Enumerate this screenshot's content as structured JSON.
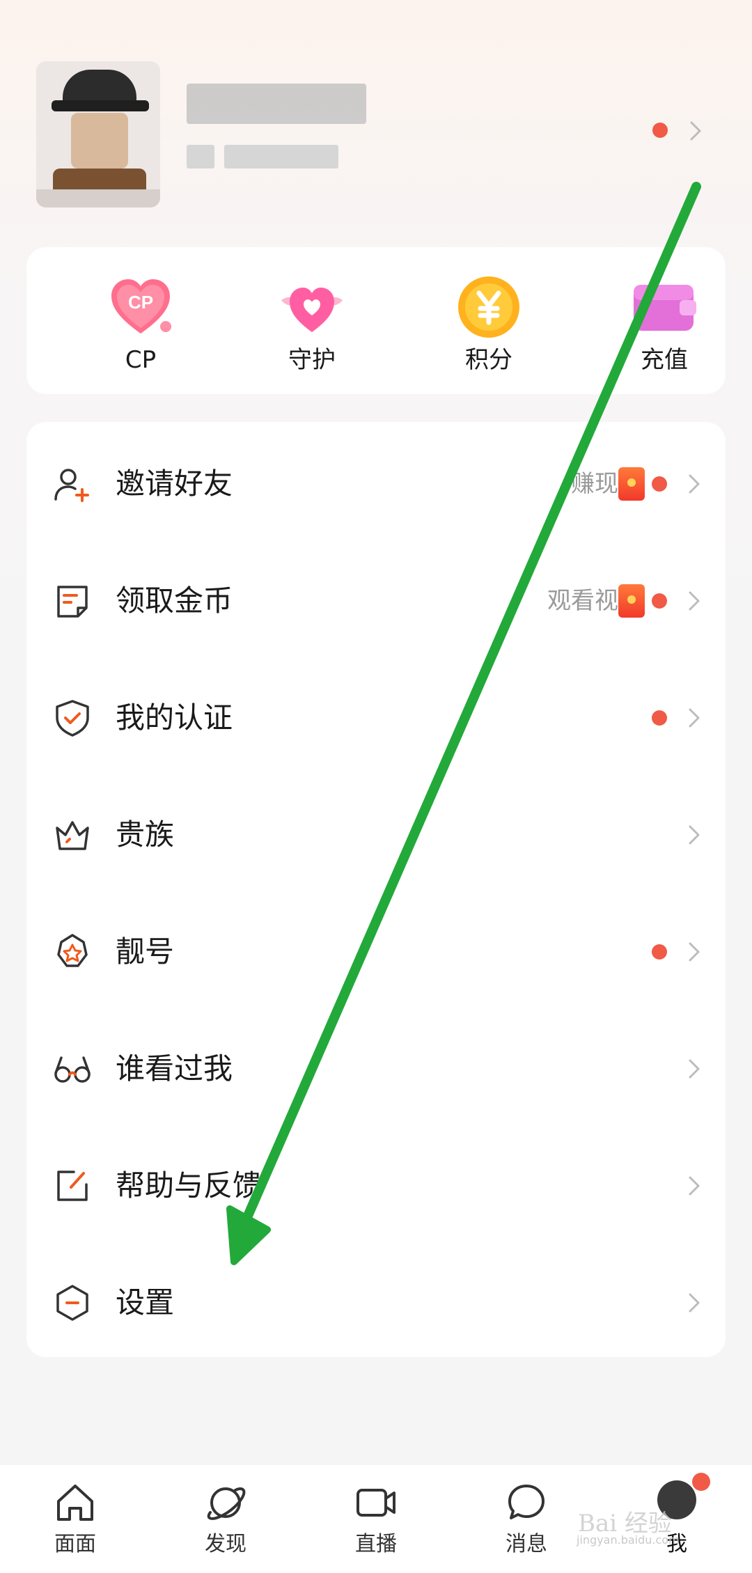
{
  "profile": {
    "has_notification": true
  },
  "quick_actions": [
    {
      "label": "CP",
      "icon": "cp-heart-icon"
    },
    {
      "label": "守护",
      "icon": "winged-heart-icon"
    },
    {
      "label": "积分",
      "icon": "yuan-coin-icon"
    },
    {
      "label": "充值",
      "icon": "wallet-icon"
    }
  ],
  "menu": [
    {
      "label": "邀请好友",
      "hint": "赚现金",
      "redpacket": true,
      "dot": true,
      "icon": "add-user-icon"
    },
    {
      "label": "领取金币",
      "hint": "观看视频",
      "redpacket": true,
      "dot": true,
      "icon": "note-icon"
    },
    {
      "label": "我的认证",
      "hint": "",
      "redpacket": false,
      "dot": true,
      "icon": "shield-check-icon"
    },
    {
      "label": "贵族",
      "hint": "",
      "redpacket": false,
      "dot": false,
      "icon": "crown-icon"
    },
    {
      "label": "靓号",
      "hint": "",
      "redpacket": false,
      "dot": true,
      "icon": "star-badge-icon"
    },
    {
      "label": "谁看过我",
      "hint": "",
      "redpacket": false,
      "dot": false,
      "icon": "glasses-icon"
    },
    {
      "label": "帮助与反馈",
      "hint": "",
      "redpacket": false,
      "dot": false,
      "icon": "edit-icon"
    },
    {
      "label": "设置",
      "hint": "",
      "redpacket": false,
      "dot": false,
      "icon": "hexagon-settings-icon"
    }
  ],
  "bottom_nav": [
    {
      "label": "面面",
      "icon": "home-icon"
    },
    {
      "label": "发现",
      "icon": "planet-icon"
    },
    {
      "label": "直播",
      "icon": "video-camera-icon"
    },
    {
      "label": "消息",
      "icon": "chat-bubble-icon"
    },
    {
      "label": "我",
      "icon": "avatar-icon",
      "active": true,
      "badge": true
    }
  ],
  "colors": {
    "accent_red": "#f05a46",
    "annotation_green": "#22a93a",
    "chevron": "#bcbcbc",
    "hint_text": "#9a9a9a"
  },
  "watermark": {
    "main": "Bai 经验",
    "sub": "jingyan.baidu.com"
  }
}
